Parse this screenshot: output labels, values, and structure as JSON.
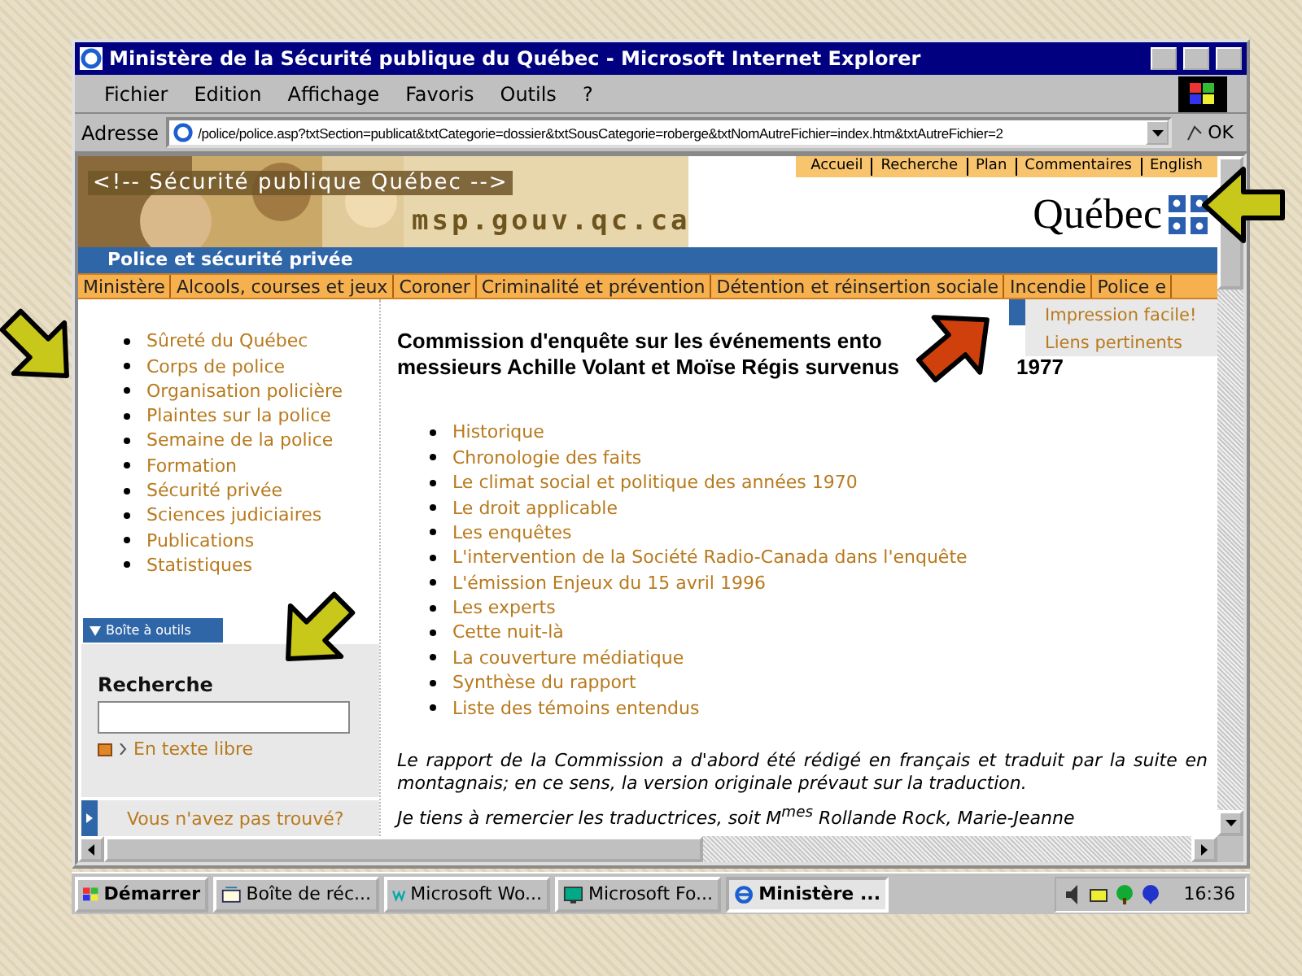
{
  "window": {
    "title": "Ministère de la Sécurité publique du Québec - Microsoft Internet Explorer"
  },
  "menu": [
    "Fichier",
    "Edition",
    "Affichage",
    "Favoris",
    "Outils",
    "?"
  ],
  "address_bar": {
    "label": "Adresse",
    "value": "/police/police.asp?txtSection=publicat&txtCategorie=dossier&txtSousCategorie=roberge&txtNomAutreFichier=index.htm&txtAutreFichier=2",
    "go": "OK"
  },
  "banner": {
    "comment_text": "<!-- Sécurité publique Québec -->",
    "site": "msp.gouv.qc.ca",
    "brand": "Québec",
    "top_links": [
      "Accueil",
      "Recherche",
      "Plan",
      "Commentaires",
      "English"
    ]
  },
  "section_title": "Police et sécurité privée",
  "nav_tabs": [
    "Ministère",
    "Alcools, courses et jeux",
    "Coroner",
    "Criminalité et prévention",
    "Détention et réinsertion sociale",
    "Incendie",
    "Police e"
  ],
  "left_nav": [
    "Sûreté du Québec",
    "Corps de police",
    "Organisation policière",
    "Plaintes sur la police",
    "Semaine de la police",
    "Formation",
    "Sécurité privée",
    "Sciences judiciaires",
    "Publications",
    "Statistiques"
  ],
  "toolbox": {
    "label": "Boîte à outils",
    "search_label": "Recherche",
    "search_link": "En texte libre",
    "not_found": "Vous n'avez pas trouvé?"
  },
  "side_menu": [
    "Impression facile!",
    "Liens pertinents"
  ],
  "heading": {
    "line_1": "Commission d'enquête sur les événements ento",
    "line_2": "messieurs Achille Volant et Moïse Régis survenus",
    "line_2_end": "1977"
  },
  "content_links": [
    "Historique",
    "Chronologie des faits",
    "Le climat social et politique des années 1970",
    "Le droit applicable",
    "Les enquêtes",
    "L'intervention de la Société Radio-Canada dans l'enquête",
    "L'émission Enjeux du 15 avril 1996",
    "Les experts",
    "Cette nuit-là",
    "La couverture médiatique",
    "Synthèse du rapport",
    "Liste des témoins entendus"
  ],
  "paragraphs": [
    "Le rapport de la Commission a d'abord été rédigé en français et traduit par la suite en montagnais; en ce sens, la version originale prévaut sur la traduction.",
    "Je tiens à remercier les traductrices, soit M$^{mes}$ Rollande Rock, Marie-Jeanne"
  ],
  "taskbar": {
    "start": "Démarrer",
    "items": [
      {
        "label": "Boîte de réc...",
        "selected": false
      },
      {
        "label": "Microsoft Wo...",
        "selected": false
      },
      {
        "label": "Microsoft Fo...",
        "selected": false
      },
      {
        "label": "Ministère ...",
        "selected": true
      }
    ],
    "clock": "16:36"
  }
}
